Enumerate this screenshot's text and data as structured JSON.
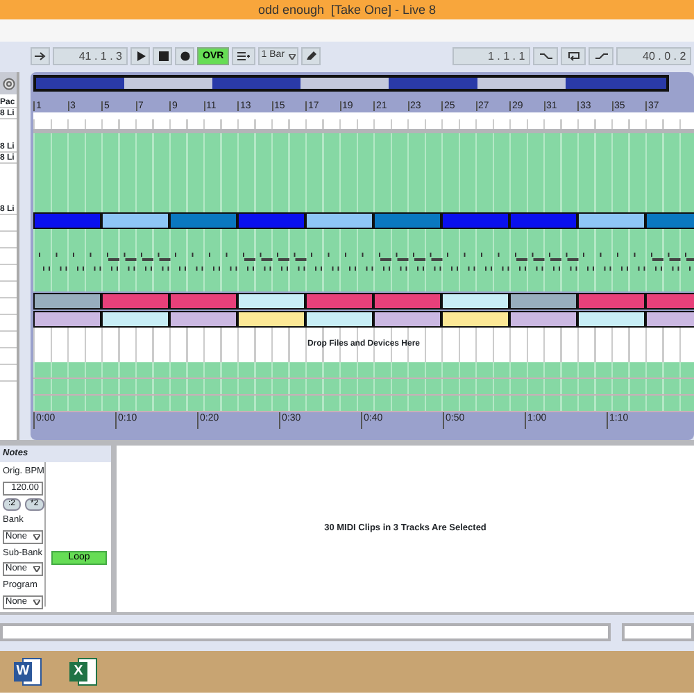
{
  "window": {
    "title": "odd enough  [Take One] - Live 8"
  },
  "transport": {
    "position": "41 . 1 . 3",
    "overdub": {
      "label": "OVR",
      "on": true
    },
    "quantization": "1 Bar",
    "loop_start": "1 . 1 . 1",
    "loop_length": "40 . 0 . 2"
  },
  "track_headers": [
    "Pac",
    "8 Li",
    "8 Li",
    "8 Li",
    "8 Li"
  ],
  "ruler": [
    "1",
    "3",
    "5",
    "7",
    "9",
    "11",
    "13",
    "15",
    "17",
    "19",
    "21",
    "23",
    "25",
    "27",
    "29",
    "31",
    "33",
    "35",
    "37"
  ],
  "clip_rows": [
    {
      "clips": [
        {
          "color": "#0a10ee"
        },
        {
          "color": "#8ec6f6"
        },
        {
          "color": "#0a78c0"
        },
        {
          "color": "#0a10ee"
        },
        {
          "color": "#8ec6f6"
        },
        {
          "color": "#0a78c0"
        },
        {
          "color": "#0a10ee"
        },
        {
          "color": "#0a10ee"
        },
        {
          "color": "#8ec6f6"
        },
        {
          "color": "#0a78c0"
        }
      ]
    },
    {
      "clips": [
        {
          "color": "#98aebe"
        },
        {
          "color": "#e8407a"
        },
        {
          "color": "#e8407a"
        },
        {
          "color": "#c8eef6"
        },
        {
          "color": "#e8407a"
        },
        {
          "color": "#e8407a"
        },
        {
          "color": "#c8eef6"
        },
        {
          "color": "#98aebe"
        },
        {
          "color": "#e8407a"
        },
        {
          "color": "#e8407a"
        }
      ]
    },
    {
      "clips": [
        {
          "color": "#cbb8e2"
        },
        {
          "color": "#c8eef6"
        },
        {
          "color": "#cbb8e2"
        },
        {
          "color": "#fce896"
        },
        {
          "color": "#c8eef6"
        },
        {
          "color": "#cbb8e2"
        },
        {
          "color": "#fce896"
        },
        {
          "color": "#cbb8e2"
        },
        {
          "color": "#c8eef6"
        },
        {
          "color": "#cbb8e2"
        }
      ]
    }
  ],
  "drop_hint": "Drop Files and Devices Here",
  "time_ruler": [
    "0:00",
    "0:10",
    "0:20",
    "0:30",
    "0:40",
    "0:50",
    "1:00",
    "1:10"
  ],
  "notes_panel": {
    "title": "Notes",
    "bpm_label": "Orig. BPM",
    "bpm": "120.00",
    "halve": ":2",
    "double": "*2",
    "fields": [
      {
        "label": "Bank",
        "value": "None"
      },
      {
        "label": "Sub-Bank",
        "value": "None"
      },
      {
        "label": "Program",
        "value": "None"
      }
    ],
    "loop": {
      "label": "Loop",
      "on": true
    }
  },
  "clip_view": {
    "message": "30 MIDI Clips in 3 Tracks Are Selected"
  },
  "taskbar": {
    "apps": [
      {
        "kind": "document",
        "letter": "W"
      },
      {
        "kind": "spreadsheet",
        "letter": "X"
      }
    ]
  }
}
